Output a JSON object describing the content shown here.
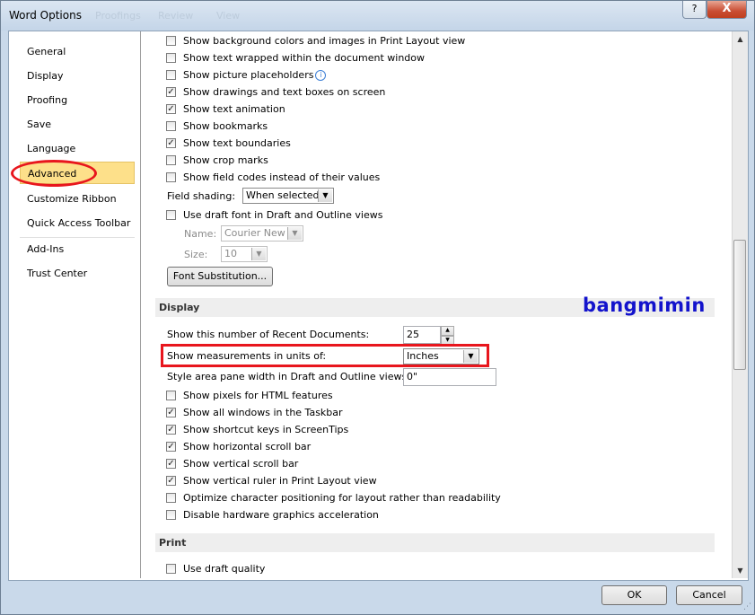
{
  "window": {
    "title": "Word Options",
    "ghost_tabs": [
      "Proofings",
      "Review",
      "View"
    ],
    "help_label": "?",
    "close_label": "X"
  },
  "nav": {
    "items": [
      {
        "label": "General"
      },
      {
        "label": "Display"
      },
      {
        "label": "Proofing"
      },
      {
        "label": "Save"
      },
      {
        "label": "Language"
      },
      {
        "label": "Advanced",
        "active": true
      },
      {
        "label": "Customize Ribbon"
      },
      {
        "label": "Quick Access Toolbar"
      },
      {
        "label": "Add-Ins"
      },
      {
        "label": "Trust Center"
      }
    ]
  },
  "show_content": {
    "options": [
      {
        "label": "Show background colors and images in Print Layout view",
        "checked": false
      },
      {
        "label": "Show text wrapped within the document window",
        "checked": false
      },
      {
        "label": "Show picture placeholders",
        "checked": false,
        "info": true
      },
      {
        "label": "Show drawings and text boxes on screen",
        "checked": true
      },
      {
        "label": "Show text animation",
        "checked": true
      },
      {
        "label": "Show bookmarks",
        "checked": false
      },
      {
        "label": "Show text boundaries",
        "checked": true
      },
      {
        "label": "Show crop marks",
        "checked": false
      },
      {
        "label": "Show field codes instead of their values",
        "checked": false
      }
    ],
    "field_shading_label": "Field shading:",
    "field_shading_value": "When selected",
    "draft_font": {
      "label": "Use draft font in Draft and Outline views",
      "checked": false
    },
    "name_label": "Name:",
    "name_value": "Courier New",
    "size_label": "Size:",
    "size_value": "10",
    "font_substitution_label": "Font Substitution..."
  },
  "display_section": {
    "header": "Display",
    "recent_docs_label": "Show this number of Recent Documents:",
    "recent_docs_value": "25",
    "measurements_label": "Show measurements in units of:",
    "measurements_value": "Inches",
    "style_area_label": "Style area pane width in Draft and Outline views:",
    "style_area_value": "0\"",
    "options": [
      {
        "label": "Show pixels for HTML features",
        "checked": false
      },
      {
        "label": "Show all windows in the Taskbar",
        "checked": true
      },
      {
        "label": "Show shortcut keys in ScreenTips",
        "checked": true
      },
      {
        "label": "Show horizontal scroll bar",
        "checked": true
      },
      {
        "label": "Show vertical scroll bar",
        "checked": true
      },
      {
        "label": "Show vertical ruler in Print Layout view",
        "checked": true
      },
      {
        "label": "Optimize character positioning for layout rather than readability",
        "checked": false
      },
      {
        "label": "Disable hardware graphics acceleration",
        "checked": false
      }
    ]
  },
  "print_section": {
    "header": "Print",
    "options": [
      {
        "label": "Use draft quality",
        "checked": false
      }
    ]
  },
  "watermark": "bangmimin",
  "footer": {
    "ok_label": "OK",
    "cancel_label": "Cancel"
  },
  "icons": {
    "check": "✓",
    "dropdown": "▼",
    "up": "▲",
    "down": "▼",
    "info": "i"
  }
}
